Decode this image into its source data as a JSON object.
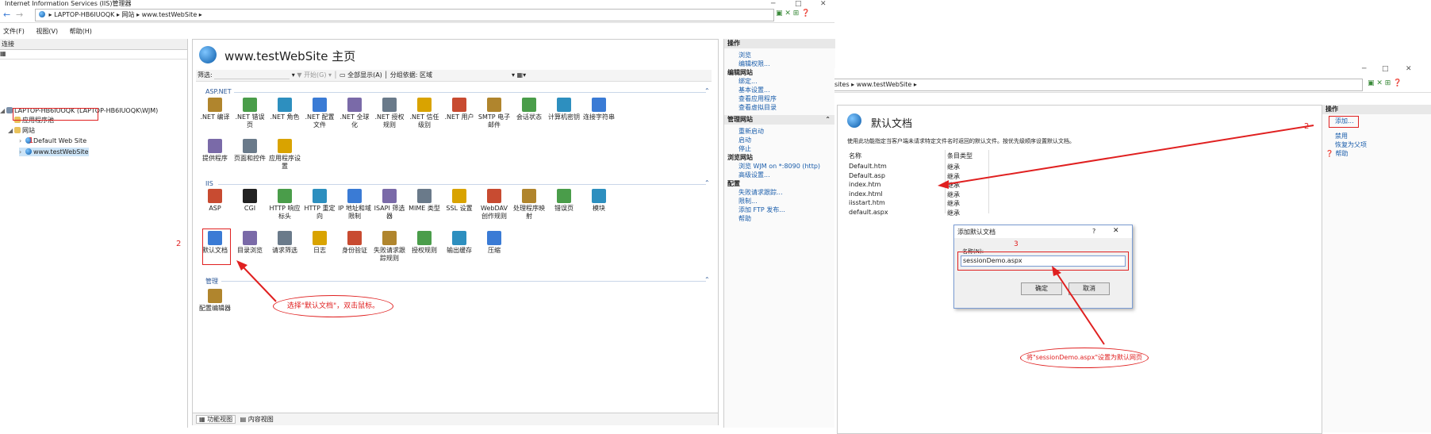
{
  "left_window": {
    "title": "Internet Information Services (IIS)管理器",
    "breadcrumb": [
      "LAPTOP-HB6IUOQK",
      "网站",
      "www.testWebSite"
    ],
    "menu": [
      "文件(F)",
      "视图(V)",
      "帮助(H)"
    ],
    "connections": {
      "header": "连接",
      "tree": [
        "LAPTOP-HB6IUOQK (LAPTOP-HB6IUOQK\\WJM)",
        "应用程序池",
        "网站",
        "Default Web Site",
        "www.testWebSite"
      ]
    },
    "main": {
      "title": "www.testWebSite 主页",
      "filter_label": "筛选:",
      "start_label": "开始(G)",
      "show_all_label": "全部显示(A)",
      "group_by_label": "分组依据:",
      "group_by_value": "区域",
      "sections": {
        "aspnet": "ASP.NET",
        "iis": "IIS",
        "manage": "管理"
      },
      "aspnet_features": [
        ".NET 编译",
        ".NET 错误页",
        ".NET 角色",
        ".NET 配置文件",
        ".NET 全球化",
        ".NET 授权规则",
        ".NET 信任级别",
        ".NET 用户",
        "SMTP 电子邮件",
        "会话状态",
        "计算机密钥",
        "连接字符串",
        "提供程序",
        "页面和控件",
        "应用程序设置"
      ],
      "iis_features": [
        "ASP",
        "CGI",
        "HTTP 响应标头",
        "HTTP 重定向",
        "IP 地址和域限制",
        "ISAPI 筛选器",
        "MIME 类型",
        "SSL 设置",
        "WebDAV 创作规则",
        "处理程序映射",
        "错误页",
        "模块",
        "默认文档",
        "目录浏览",
        "请求筛选",
        "日志",
        "身份验证",
        "失败请求跟踪规则",
        "授权规则",
        "输出缓存",
        "压缩"
      ],
      "manage_features": [
        "配置编辑器"
      ],
      "bottom_tabs": [
        "功能视图",
        "内容视图"
      ]
    },
    "actions": {
      "header": "操作",
      "items": [
        {
          "type": "link",
          "label": "浏览"
        },
        {
          "type": "link",
          "label": "编辑权限..."
        },
        {
          "type": "sub",
          "label": "编辑网站"
        },
        {
          "type": "link",
          "label": "绑定..."
        },
        {
          "type": "link",
          "label": "基本设置..."
        },
        {
          "type": "link",
          "label": "查看应用程序"
        },
        {
          "type": "link",
          "label": "查看虚拟目录"
        }
      ],
      "manage_header": "管理网站",
      "manage_items": [
        {
          "type": "link",
          "label": "重新启动"
        },
        {
          "type": "link",
          "label": "启动"
        },
        {
          "type": "link",
          "label": "停止"
        },
        {
          "type": "sub",
          "label": "浏览网站"
        },
        {
          "type": "link",
          "label": "浏览 WJM on *:8090 (http)"
        },
        {
          "type": "link",
          "label": "高级设置..."
        },
        {
          "type": "sub",
          "label": "配置"
        },
        {
          "type": "link",
          "label": "失败请求跟踪..."
        },
        {
          "type": "link",
          "label": "限制..."
        },
        {
          "type": "link",
          "label": "添加 FTP 发布..."
        },
        {
          "type": "link",
          "label": "帮助"
        }
      ]
    }
  },
  "right_window": {
    "breadcrumb": "sites ▸ www.testWebSite ▸",
    "page_title": "默认文档",
    "description": "使用此功能指定当客户端未请求特定文件名时返回的默认文件。按优先级顺序设置默认文档。",
    "columns": [
      "名称",
      "条目类型"
    ],
    "rows": [
      [
        "Default.htm",
        "继承"
      ],
      [
        "Default.asp",
        "继承"
      ],
      [
        "index.htm",
        "继承"
      ],
      [
        "index.html",
        "继承"
      ],
      [
        "iisstart.htm",
        "继承"
      ],
      [
        "default.aspx",
        "继承"
      ]
    ],
    "actions": {
      "header": "操作",
      "items": [
        "添加...",
        "禁用",
        "恢复为父项",
        "帮助"
      ]
    },
    "dialog": {
      "title": "添加默认文档",
      "help": "?",
      "close": "✕",
      "name_label": "名称(N):",
      "name_value": "sessionDemo.aspx",
      "ok": "确定",
      "cancel": "取消"
    }
  },
  "annotations": {
    "n1": "1",
    "n2_left": "2",
    "n2_right": "2",
    "n3": "3",
    "bubble_left": "选择\"默认文档\"，双击鼠标。",
    "bubble_right": "将\"sessionDemo.aspx\"设置为默认网页"
  },
  "colors": {
    "annotation": "#e02020",
    "link": "#1a5dab",
    "section": "#2b5797"
  }
}
